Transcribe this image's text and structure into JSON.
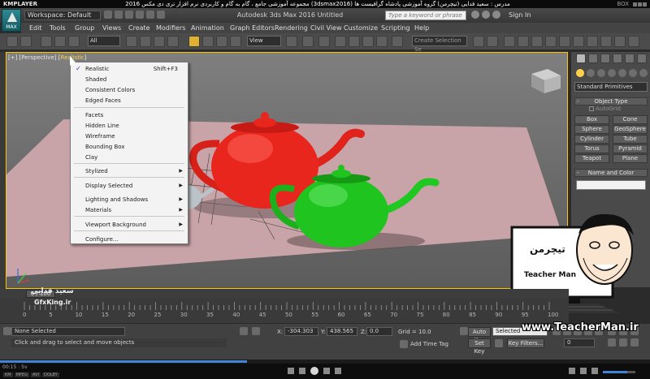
{
  "kmplayer": {
    "brand": "KMPLAYER",
    "video_title": "مجموعه آموزشی جامع ، گام به گام و کاربردی نرم افزار تری دی مکس 2016 (3dsmax2016) مدرس : سعید فدایی (تیچرمن) گروه آموزشی پادشاه گرافیست ها",
    "box_label": "BOX",
    "time": "00:15 : 5v",
    "badges": [
      "KM",
      "MPEG",
      "AVI",
      "DOLBY"
    ],
    "progress": 0.38,
    "volume": 0.75
  },
  "titlebar": {
    "workspace": "Workspace: Default",
    "app_title": "Autodesk 3ds Max 2016    Untitled",
    "search_placeholder": "Type a keyword or phrase",
    "sign_in": "Sign In",
    "logo_text": "MAX"
  },
  "menubar": {
    "items": [
      "Edit",
      "Tools",
      "Group",
      "Views",
      "Create",
      "Modifiers",
      "Animation",
      "Graph Editors",
      "Rendering",
      "Civil View",
      "Customize",
      "Scripting",
      "Help"
    ]
  },
  "toolbar": {
    "filter_value": "All",
    "ref_coord_value": "View",
    "selection_set_placeholder": "Create Selection Se"
  },
  "viewport": {
    "label_prefix": "[+] [Perspective] [",
    "label_mode": "Realistic",
    "label_suffix": "]"
  },
  "context_menu": {
    "items": [
      {
        "label": "Realistic",
        "shortcut": "Shift+F3",
        "checked": true,
        "submenu": false
      },
      {
        "label": "Shaded",
        "shortcut": "",
        "checked": false,
        "submenu": false
      },
      {
        "label": "Consistent Colors",
        "shortcut": "",
        "checked": false,
        "submenu": false
      },
      {
        "label": "Edged Faces",
        "shortcut": "",
        "checked": false,
        "submenu": false
      },
      {
        "label": "Facets",
        "shortcut": "",
        "checked": false,
        "submenu": false
      },
      {
        "label": "Hidden Line",
        "shortcut": "",
        "checked": false,
        "submenu": false
      },
      {
        "label": "Wireframe",
        "shortcut": "",
        "checked": false,
        "submenu": false
      },
      {
        "label": "Bounding Box",
        "shortcut": "",
        "checked": false,
        "submenu": false
      },
      {
        "label": "Clay",
        "shortcut": "",
        "checked": false,
        "submenu": false
      },
      {
        "label": "Stylized",
        "shortcut": "",
        "checked": false,
        "submenu": true
      },
      {
        "label": "Display Selected",
        "shortcut": "",
        "checked": false,
        "submenu": true
      },
      {
        "label": "Lighting and Shadows",
        "shortcut": "",
        "checked": false,
        "submenu": true
      },
      {
        "label": "Materials",
        "shortcut": "",
        "checked": false,
        "submenu": true
      },
      {
        "label": "Viewport Background",
        "shortcut": "",
        "checked": false,
        "submenu": true
      },
      {
        "label": "Configure...",
        "shortcut": "",
        "checked": false,
        "submenu": false
      }
    ],
    "check_glyph": "✓",
    "arrow_glyph": "▶"
  },
  "command_panel": {
    "category": "Standard Primitives",
    "object_type_title": "Object Type",
    "autogrid": "AutoGrid",
    "buttons": [
      "Box",
      "Cone",
      "Sphere",
      "GeoSphere",
      "Cylinder",
      "Tube",
      "Torus",
      "Pyramid",
      "Teapot",
      "Plane"
    ],
    "name_color_title": "Name and Color",
    "rollout_sign": "-"
  },
  "timeline": {
    "slider_label": "0 / 100",
    "frame_numbers": [
      "0",
      "5",
      "10",
      "15",
      "20",
      "25",
      "30",
      "35",
      "40",
      "45",
      "50",
      "55",
      "60",
      "65",
      "70",
      "75",
      "80",
      "85",
      "90",
      "95",
      "100"
    ]
  },
  "status": {
    "selection": "None Selected",
    "prompt": "Click and drag to select and move objects",
    "x_label": "X:",
    "x_value": "-304.303",
    "y_label": "Y:",
    "y_value": "438.565",
    "z_label": "Z:",
    "z_value": "0.0",
    "grid": "Grid = 10.0",
    "add_time_tag": "Add Time Tag",
    "auto_key": "Auto Key",
    "set_key": "Set Key",
    "key_mode_value": "Selected",
    "key_filters": "Key Filters...",
    "frame_value": "0"
  },
  "overlay": {
    "url": "www.TeacherMan.ir",
    "caption": "Teacher Man",
    "mark": "تیچرمن",
    "watermark_name": "سعید فدایی",
    "watermark_site": "GfxKing.ir"
  },
  "colors": {
    "teapot_red": "#e8261e",
    "teapot_green": "#1fc41f",
    "ground": "#c8a3a6",
    "viewport_border": "#ffc400",
    "accent": "#3f84d6"
  }
}
